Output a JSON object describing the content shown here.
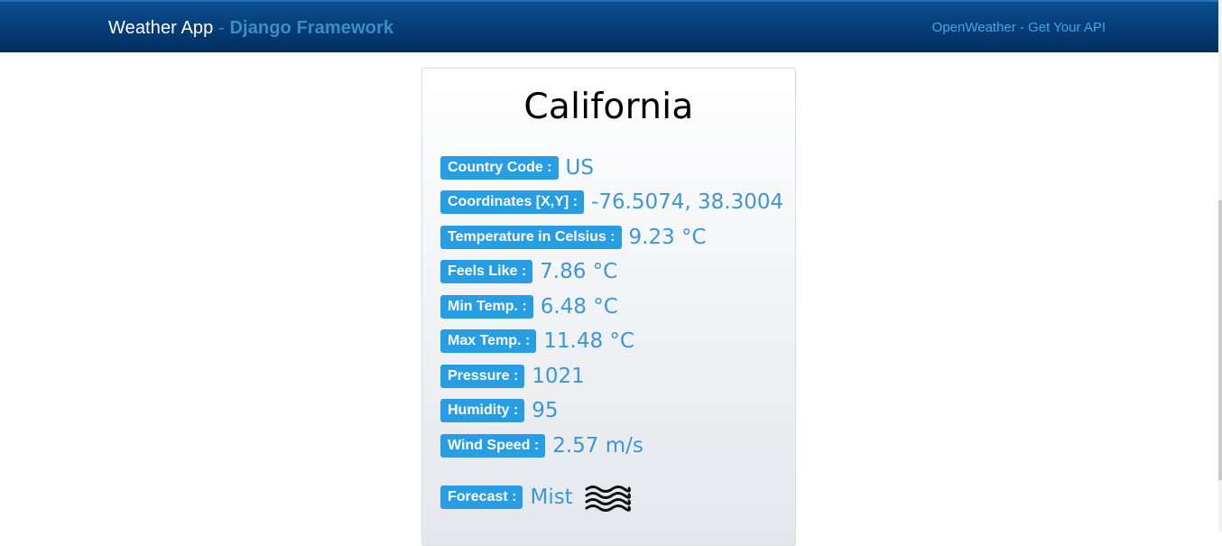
{
  "navbar": {
    "brand_main": "Weather App",
    "brand_sep": " - ",
    "brand_sub": "Django Framework",
    "link": "OpenWeather - Get Your API"
  },
  "card": {
    "city": "California",
    "rows": [
      {
        "label": "Country Code :",
        "value": "US"
      },
      {
        "label": "Coordinates [X,Y] :",
        "value": "-76.5074, 38.3004"
      },
      {
        "label": "Temperature in Celsius :",
        "value": "9.23 °C"
      },
      {
        "label": "Feels Like :",
        "value": "7.86 °C"
      },
      {
        "label": "Min Temp. :",
        "value": "6.48 °C"
      },
      {
        "label": "Max Temp. :",
        "value": "11.48 °C"
      },
      {
        "label": "Pressure :",
        "value": "1021"
      },
      {
        "label": "Humidity :",
        "value": "95"
      },
      {
        "label": "Wind Speed :",
        "value": "2.57 m/s"
      }
    ],
    "forecast": {
      "label": "Forecast :",
      "value": "Mist",
      "icon": "mist-icon"
    }
  },
  "colors": {
    "navbar": "#053a72",
    "badge": "#279ee3",
    "value_text": "#3c96d8",
    "link": "#3fa5ec"
  }
}
